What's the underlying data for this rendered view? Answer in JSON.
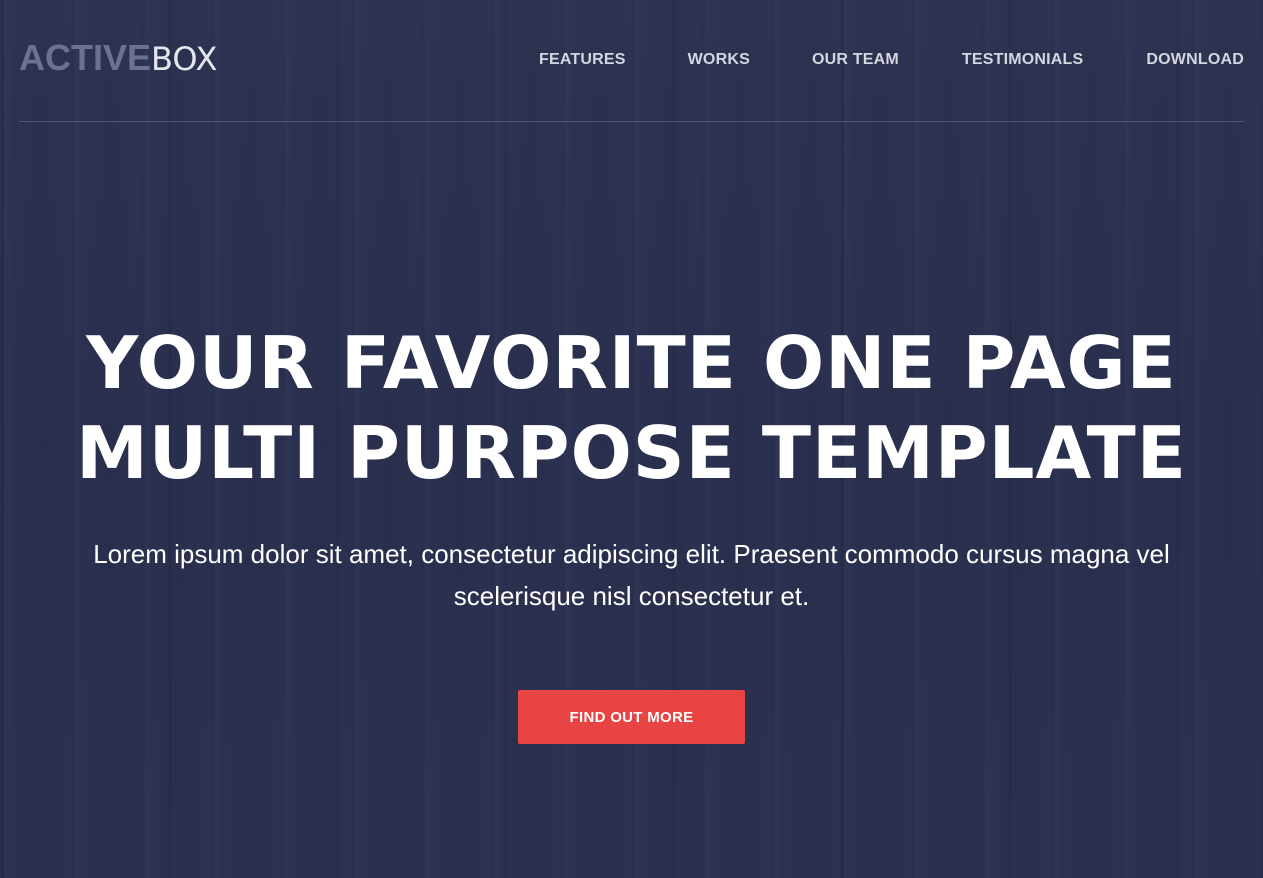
{
  "header": {
    "logo": {
      "strong": "ACTIVE",
      "light": "BOX"
    },
    "nav": [
      {
        "label": "FEATURES"
      },
      {
        "label": "WORKS"
      },
      {
        "label": "OUR TEAM"
      },
      {
        "label": "TESTIMONIALS"
      },
      {
        "label": "DOWNLOAD"
      }
    ]
  },
  "hero": {
    "title_line1": "YOUR FAVORITE ONE PAGE",
    "title_line2": "MULTI PURPOSE TEMPLATE",
    "subtitle_line1": "Lorem ipsum dolor sit amet, consectetur adipiscing elit. Praesent commodo cursus magna vel",
    "subtitle_line2": "scelerisque nisl consectetur et.",
    "cta_label": "FIND OUT MORE"
  },
  "colors": {
    "background": "#2b3150",
    "accent": "#e84444",
    "logo_strong": "#6b7190",
    "nav_text": "#d4d6e0"
  }
}
